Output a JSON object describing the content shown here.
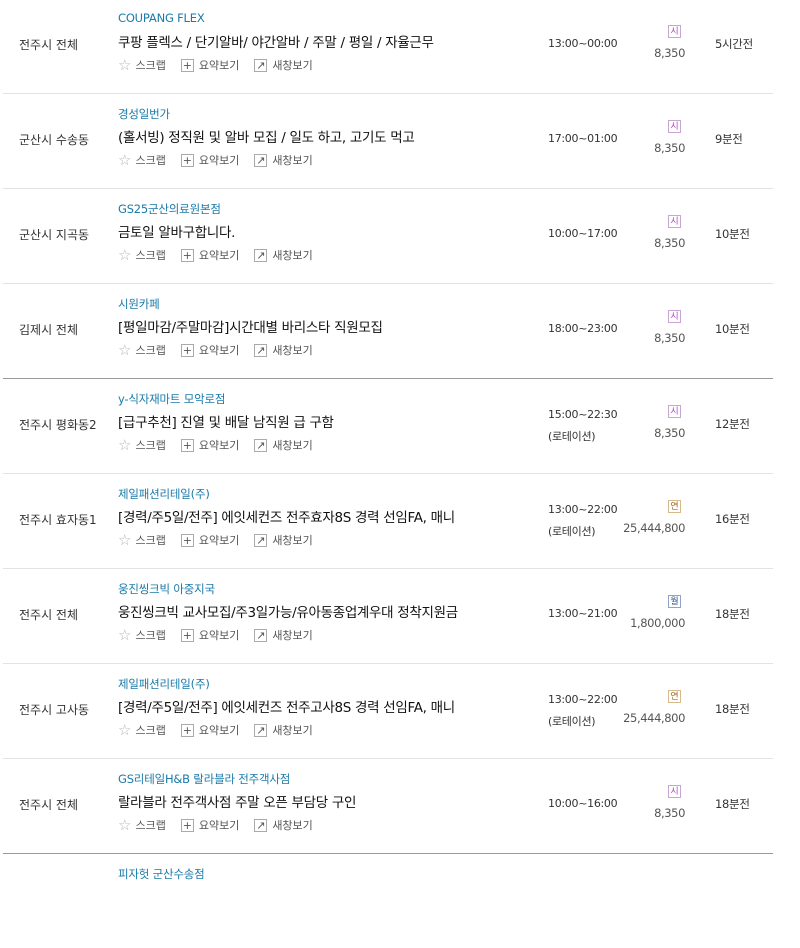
{
  "actions": {
    "scrap": "스크랩",
    "summary": "요약보기",
    "newwin": "새창보기"
  },
  "colors": {
    "company": "#1a7aa8",
    "badge_hourly": "#a84cb8",
    "badge_yearly": "#9a6a22",
    "badge_monthly": "#2f4f8f"
  },
  "rows": [
    {
      "region": "전주시 전체",
      "company": "COUPANG FLEX",
      "title": "쿠팡 플렉스 / 단기알바/ 야간알바 / 주말 / 평일 / 자율근무",
      "time": "13:00~00:00",
      "time_note": "",
      "pay_type": "시",
      "pay": "8,350",
      "ago": "5시간전"
    },
    {
      "region": "군산시 수송동",
      "company": "경성일번가",
      "title": "(홀서빙) 정직원 및 알바 모집 / 일도 하고, 고기도 먹고",
      "time": "17:00~01:00",
      "time_note": "",
      "pay_type": "시",
      "pay": "8,350",
      "ago": "9분전"
    },
    {
      "region": "군산시 지곡동",
      "company": "GS25군산의료원본점",
      "title": "금토일 알바구합니다.",
      "time": "10:00~17:00",
      "time_note": "",
      "pay_type": "시",
      "pay": "8,350",
      "ago": "10분전"
    },
    {
      "region": "김제시 전체",
      "company": "시원카페",
      "title": "[평일마감/주말마감]시간대별 바리스타 직원모집",
      "time": "18:00~23:00",
      "time_note": "",
      "pay_type": "시",
      "pay": "8,350",
      "ago": "10분전"
    },
    {
      "region": "전주시 평화동2",
      "company": "y-식자재마트 모악로점",
      "title": "[급구추천] 진열 및 배달 남직원 급 구함",
      "time": "15:00~22:30",
      "time_note": "(로테이션)",
      "pay_type": "시",
      "pay": "8,350",
      "ago": "12분전"
    },
    {
      "region": "전주시 효자동1",
      "company": "제일패션리테일(주)",
      "title": "[경력/주5일/전주] 에잇세컨즈 전주효자8S 경력 선임FA, 매니",
      "time": "13:00~22:00",
      "time_note": "(로테이션)",
      "pay_type": "연",
      "pay": "25,444,800",
      "ago": "16분전"
    },
    {
      "region": "전주시 전체",
      "company": "웅진씽크빅 아중지국",
      "title": "웅진씽크빅 교사모집/주3일가능/유아동종업계우대 정착지원금",
      "time": "13:00~21:00",
      "time_note": "",
      "pay_type": "월",
      "pay": "1,800,000",
      "ago": "18분전"
    },
    {
      "region": "전주시 고사동",
      "company": "제일패션리테일(주)",
      "title": "[경력/주5일/전주] 에잇세컨즈 전주고사8S 경력 선임FA, 매니",
      "time": "13:00~22:00",
      "time_note": "(로테이션)",
      "pay_type": "연",
      "pay": "25,444,800",
      "ago": "18분전"
    },
    {
      "region": "전주시 전체",
      "company": "GS리테일H&B 랄라블라 전주객사점",
      "title": "랄라블라 전주객사점 주말 오픈 부담당 구인",
      "time": "10:00~16:00",
      "time_note": "",
      "pay_type": "시",
      "pay": "8,350",
      "ago": "18분전"
    },
    {
      "region": "",
      "company": "피자헛 군산수송점",
      "title": "",
      "time": "",
      "time_note": "",
      "pay_type": "",
      "pay": "",
      "ago": ""
    }
  ]
}
